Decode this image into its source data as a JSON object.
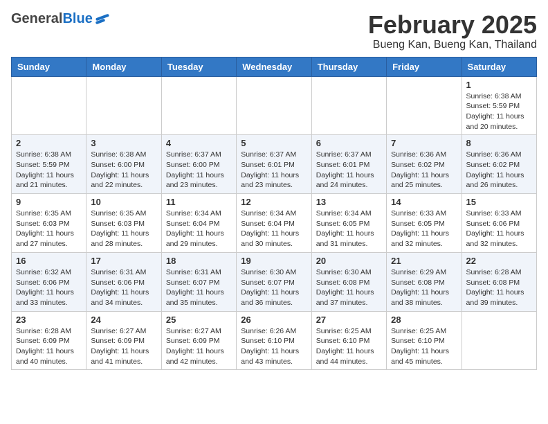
{
  "header": {
    "logo_general": "General",
    "logo_blue": "Blue",
    "month_title": "February 2025",
    "location": "Bueng Kan, Bueng Kan, Thailand"
  },
  "weekdays": [
    "Sunday",
    "Monday",
    "Tuesday",
    "Wednesday",
    "Thursday",
    "Friday",
    "Saturday"
  ],
  "weeks": [
    [
      {
        "day": "",
        "info": ""
      },
      {
        "day": "",
        "info": ""
      },
      {
        "day": "",
        "info": ""
      },
      {
        "day": "",
        "info": ""
      },
      {
        "day": "",
        "info": ""
      },
      {
        "day": "",
        "info": ""
      },
      {
        "day": "1",
        "info": "Sunrise: 6:38 AM\nSunset: 5:59 PM\nDaylight: 11 hours and 20 minutes."
      }
    ],
    [
      {
        "day": "2",
        "info": "Sunrise: 6:38 AM\nSunset: 5:59 PM\nDaylight: 11 hours and 21 minutes."
      },
      {
        "day": "3",
        "info": "Sunrise: 6:38 AM\nSunset: 6:00 PM\nDaylight: 11 hours and 22 minutes."
      },
      {
        "day": "4",
        "info": "Sunrise: 6:37 AM\nSunset: 6:00 PM\nDaylight: 11 hours and 23 minutes."
      },
      {
        "day": "5",
        "info": "Sunrise: 6:37 AM\nSunset: 6:01 PM\nDaylight: 11 hours and 23 minutes."
      },
      {
        "day": "6",
        "info": "Sunrise: 6:37 AM\nSunset: 6:01 PM\nDaylight: 11 hours and 24 minutes."
      },
      {
        "day": "7",
        "info": "Sunrise: 6:36 AM\nSunset: 6:02 PM\nDaylight: 11 hours and 25 minutes."
      },
      {
        "day": "8",
        "info": "Sunrise: 6:36 AM\nSunset: 6:02 PM\nDaylight: 11 hours and 26 minutes."
      }
    ],
    [
      {
        "day": "9",
        "info": "Sunrise: 6:35 AM\nSunset: 6:03 PM\nDaylight: 11 hours and 27 minutes."
      },
      {
        "day": "10",
        "info": "Sunrise: 6:35 AM\nSunset: 6:03 PM\nDaylight: 11 hours and 28 minutes."
      },
      {
        "day": "11",
        "info": "Sunrise: 6:34 AM\nSunset: 6:04 PM\nDaylight: 11 hours and 29 minutes."
      },
      {
        "day": "12",
        "info": "Sunrise: 6:34 AM\nSunset: 6:04 PM\nDaylight: 11 hours and 30 minutes."
      },
      {
        "day": "13",
        "info": "Sunrise: 6:34 AM\nSunset: 6:05 PM\nDaylight: 11 hours and 31 minutes."
      },
      {
        "day": "14",
        "info": "Sunrise: 6:33 AM\nSunset: 6:05 PM\nDaylight: 11 hours and 32 minutes."
      },
      {
        "day": "15",
        "info": "Sunrise: 6:33 AM\nSunset: 6:06 PM\nDaylight: 11 hours and 32 minutes."
      }
    ],
    [
      {
        "day": "16",
        "info": "Sunrise: 6:32 AM\nSunset: 6:06 PM\nDaylight: 11 hours and 33 minutes."
      },
      {
        "day": "17",
        "info": "Sunrise: 6:31 AM\nSunset: 6:06 PM\nDaylight: 11 hours and 34 minutes."
      },
      {
        "day": "18",
        "info": "Sunrise: 6:31 AM\nSunset: 6:07 PM\nDaylight: 11 hours and 35 minutes."
      },
      {
        "day": "19",
        "info": "Sunrise: 6:30 AM\nSunset: 6:07 PM\nDaylight: 11 hours and 36 minutes."
      },
      {
        "day": "20",
        "info": "Sunrise: 6:30 AM\nSunset: 6:08 PM\nDaylight: 11 hours and 37 minutes."
      },
      {
        "day": "21",
        "info": "Sunrise: 6:29 AM\nSunset: 6:08 PM\nDaylight: 11 hours and 38 minutes."
      },
      {
        "day": "22",
        "info": "Sunrise: 6:28 AM\nSunset: 6:08 PM\nDaylight: 11 hours and 39 minutes."
      }
    ],
    [
      {
        "day": "23",
        "info": "Sunrise: 6:28 AM\nSunset: 6:09 PM\nDaylight: 11 hours and 40 minutes."
      },
      {
        "day": "24",
        "info": "Sunrise: 6:27 AM\nSunset: 6:09 PM\nDaylight: 11 hours and 41 minutes."
      },
      {
        "day": "25",
        "info": "Sunrise: 6:27 AM\nSunset: 6:09 PM\nDaylight: 11 hours and 42 minutes."
      },
      {
        "day": "26",
        "info": "Sunrise: 6:26 AM\nSunset: 6:10 PM\nDaylight: 11 hours and 43 minutes."
      },
      {
        "day": "27",
        "info": "Sunrise: 6:25 AM\nSunset: 6:10 PM\nDaylight: 11 hours and 44 minutes."
      },
      {
        "day": "28",
        "info": "Sunrise: 6:25 AM\nSunset: 6:10 PM\nDaylight: 11 hours and 45 minutes."
      },
      {
        "day": "",
        "info": ""
      }
    ]
  ]
}
